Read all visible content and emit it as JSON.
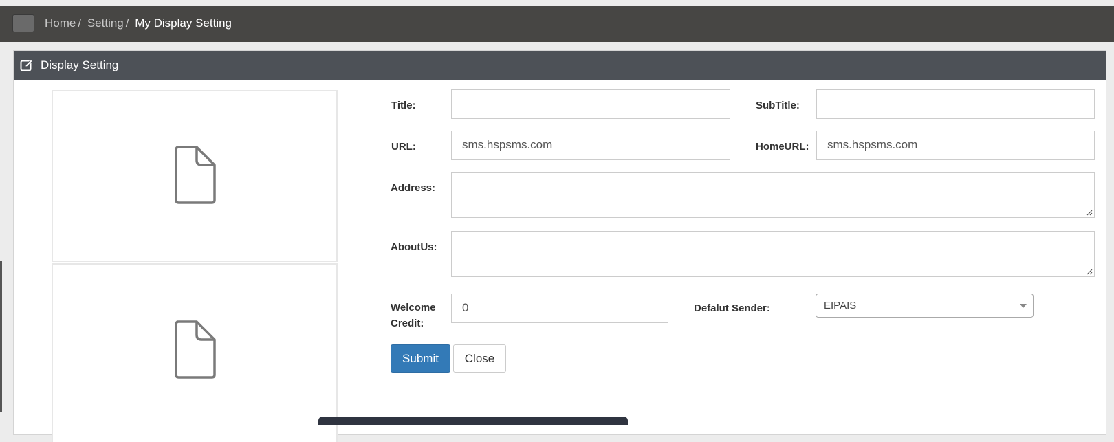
{
  "breadcrumb": {
    "items": [
      "Home",
      "Setting"
    ],
    "separator": "/",
    "current": "My Display Setting"
  },
  "panel": {
    "title": "Display Setting",
    "icon": "edit-icon"
  },
  "form": {
    "title_label": "Title:",
    "title_value": "",
    "subtitle_label": "SubTitle:",
    "subtitle_value": "",
    "url_label": "URL:",
    "url_value": "sms.hspsms.com",
    "homeurl_label": "HomeURL:",
    "homeurl_value": "sms.hspsms.com",
    "address_label": "Address:",
    "address_value": "",
    "aboutus_label": "AboutUs:",
    "aboutus_value": "",
    "welcome_credit_label_line1": "Welcome",
    "welcome_credit_label_line2": "Credit:",
    "welcome_credit_value": "0",
    "default_sender_label": "Defalut Sender:",
    "default_sender_value": "EIPAIS",
    "submit_label": "Submit",
    "close_label": "Close"
  },
  "images": [
    {
      "icon": "file-icon"
    },
    {
      "icon": "file-icon"
    }
  ],
  "colors": {
    "navbar": "#474644",
    "panel_heading": "#4d5157",
    "primary_button": "#337ab7"
  }
}
